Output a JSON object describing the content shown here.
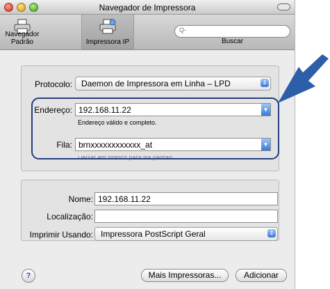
{
  "window": {
    "title": "Navegador de Impressora"
  },
  "toolbar": {
    "default_browser_label": "Navegador Padrão",
    "ip_printer_label": "Impressora IP",
    "search_placeholder": "Q-",
    "search_label": "Buscar"
  },
  "protocol": {
    "label": "Protocolo:",
    "value": "Daemon de Impressora em Linha – LPD"
  },
  "address": {
    "label": "Endereço:",
    "value": "192.168.11.22",
    "hint": "Endereço válido e completo."
  },
  "queue": {
    "label": "Fila:",
    "value": "brnxxxxxxxxxxxx_at",
    "hint_partial": "Deixar em branco para fila padrão."
  },
  "name": {
    "label": "Nome:",
    "value": "192.168.11.22"
  },
  "location": {
    "label": "Localização:",
    "value": ""
  },
  "print_using": {
    "label": "Imprimir Usando:",
    "value": "Impressora PostScript Geral"
  },
  "buttons": {
    "help": "?",
    "more_printers": "Mais Impressoras...",
    "add": "Adicionar"
  },
  "colors": {
    "callout": "#243e7f",
    "arrow": "#2d5fa8",
    "accent": "#3a78d6"
  },
  "icons": {
    "window_controls": [
      "close-icon",
      "minimize-icon",
      "zoom-icon"
    ],
    "toolbar": [
      "printer-icon",
      "network-printer-icon",
      "search-icon"
    ],
    "popup": "updown-chevron-icon",
    "callout": "arrow-icon"
  }
}
